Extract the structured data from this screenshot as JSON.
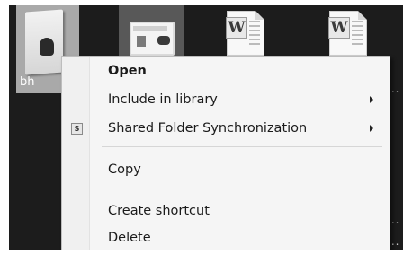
{
  "desktop": {
    "icons": [
      {
        "label": "bh",
        "icon": "user-folder-icon",
        "selected": true
      },
      {
        "label": "",
        "icon": "app-window-icon",
        "selected": true
      },
      {
        "label": "",
        "icon": "word-document-icon",
        "selected": false
      },
      {
        "label": "",
        "icon": "word-document-icon",
        "selected": false
      }
    ],
    "word_badge": "W",
    "overflow_dots": "..."
  },
  "context_menu": {
    "items": [
      {
        "label": "Open",
        "bold": true,
        "submenu": false,
        "icon": ""
      },
      {
        "label": "Include in library",
        "bold": false,
        "submenu": true,
        "icon": ""
      },
      {
        "label": "Shared Folder Synchronization",
        "bold": false,
        "submenu": true,
        "icon": "sync-icon",
        "icon_glyph": "S"
      },
      {
        "label": "Copy",
        "bold": false,
        "submenu": false,
        "icon": ""
      },
      {
        "label": "Create shortcut",
        "bold": false,
        "submenu": false,
        "icon": ""
      },
      {
        "label": "Delete",
        "bold": false,
        "submenu": false,
        "icon": ""
      }
    ]
  },
  "colors": {
    "desktop_bg": "#1c1c1c",
    "menu_bg": "#f5f5f5",
    "selection": "#a9a9a9"
  }
}
